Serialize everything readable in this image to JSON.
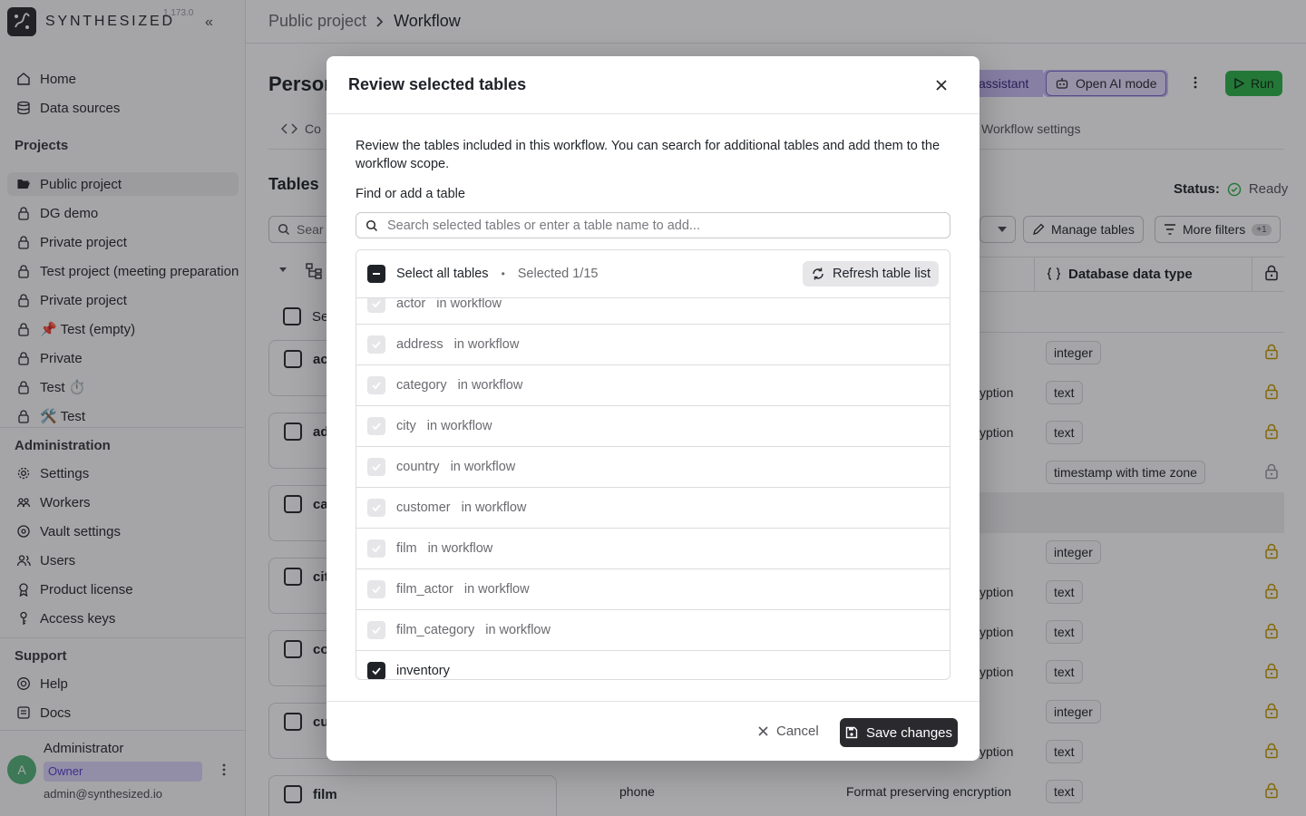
{
  "app": {
    "brand": "SYNTHESIZED",
    "version": "1.173.0"
  },
  "sidebar": {
    "items": [
      {
        "label": "Home"
      },
      {
        "label": "Data sources"
      }
    ],
    "projects_title": "Projects",
    "projects": [
      {
        "label": "Public project"
      },
      {
        "label": "DG demo"
      },
      {
        "label": "Private project"
      },
      {
        "label": "Test project (meeting preparation"
      },
      {
        "label": "Private project"
      },
      {
        "label": "📌 Test (empty)"
      },
      {
        "label": "Private"
      },
      {
        "label": "Test ⏱️"
      },
      {
        "label": "🛠️ Test"
      }
    ],
    "admin_title": "Administration",
    "admin": [
      {
        "label": "Settings"
      },
      {
        "label": "Workers"
      },
      {
        "label": "Vault settings"
      },
      {
        "label": "Users"
      },
      {
        "label": "Product license"
      },
      {
        "label": "Access keys"
      }
    ],
    "support_title": "Support",
    "support": [
      {
        "label": "Help"
      },
      {
        "label": "Docs"
      }
    ],
    "user": {
      "initial": "A",
      "name": "Administrator",
      "role": "Owner",
      "email": "admin@synthesized.io"
    }
  },
  "breadcrumb": {
    "project": "Public project",
    "page": "Workflow"
  },
  "background": {
    "title_partial": "Person",
    "assistant_partial": "assistant",
    "ai_mode": "Open AI mode",
    "run": "Run",
    "tab_partial": "Co",
    "workflow_settings": "Workflow settings",
    "tables_title": "Tables",
    "status_label": "Status:",
    "status_value": "Ready",
    "search_partial": "Sear",
    "manage_tables": "Manage tables",
    "more_filters": "More filters",
    "filter_count": "+1",
    "db_type_header": "Database data type",
    "select_partial": "Se",
    "cards": [
      "ac",
      "ad",
      "ca",
      "cit",
      "co",
      "cu",
      "film"
    ],
    "type_pills": [
      "integer",
      "text",
      "text",
      "timestamp with time zone",
      "integer",
      "text",
      "text",
      "text",
      "integer",
      "text",
      "text"
    ],
    "enc_partial": "yption",
    "last_row_col": "phone",
    "last_row_method": "Format preserving encryption"
  },
  "modal": {
    "title": "Review selected tables",
    "description": "Review the tables included in this workflow. You can search for additional tables and add them to the workflow scope.",
    "find_label": "Find or add a table",
    "search_placeholder": "Search selected tables or enter a table name to add...",
    "select_all": "Select all tables",
    "selected_count": "Selected 1/15",
    "refresh": "Refresh table list",
    "rows": [
      {
        "name": "actor",
        "tag": "in workflow",
        "checked": false
      },
      {
        "name": "address",
        "tag": "in workflow",
        "checked": false
      },
      {
        "name": "category",
        "tag": "in workflow",
        "checked": false
      },
      {
        "name": "city",
        "tag": "in workflow",
        "checked": false
      },
      {
        "name": "country",
        "tag": "in workflow",
        "checked": false
      },
      {
        "name": "customer",
        "tag": "in workflow",
        "checked": false
      },
      {
        "name": "film",
        "tag": "in workflow",
        "checked": false
      },
      {
        "name": "film_actor",
        "tag": "in workflow",
        "checked": false
      },
      {
        "name": "film_category",
        "tag": "in workflow",
        "checked": false
      },
      {
        "name": "inventory",
        "tag": "",
        "checked": true
      }
    ],
    "cancel": "Cancel",
    "save": "Save changes"
  },
  "colors": {
    "run_green": "#2fb34a",
    "ai_purple": "#cbbff5",
    "owner_badge": "#ddd6fb",
    "status_green": "#2fb34a"
  }
}
